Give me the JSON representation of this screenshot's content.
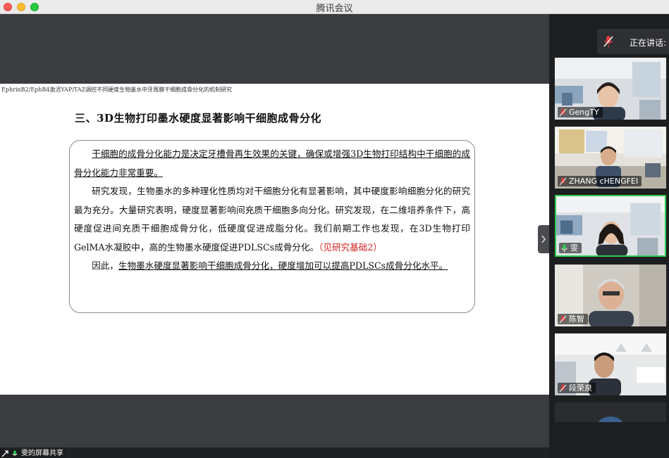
{
  "window": {
    "title": "腾讯会议"
  },
  "slide": {
    "header": "EphrinB2/EphB4激活YAP/TAZ调控不同硬度生物墨水中牙周膜干细胞成骨分化的机制研究",
    "heading": "三、3D生物打印墨水硬度显著影响干细胞成骨分化",
    "p1": "干细胞的成骨分化能力是决定牙槽骨再生效果的关键，确保或增强3D生物打印结构中干细胞的成骨分化能力非常重要。",
    "p2": "研究发现，生物墨水的多种理化性质均对干细胞分化有显著影响，其中硬度影响细胞分化的研究最为充分。大量研究表明，硬度显著影响间充质干细胞多向分化。研究发现，在二维培养条件下，高硬度促进间充质干细胞成骨分化，低硬度促进成脂分化。我们前期工作也发现，在3D生物打印GelMA水凝胶中，高的生物墨水硬度促进PDLSCs成骨分化。",
    "p2_ref": "（见研究基础2）",
    "p3_lead": "因此，",
    "p3_underline": "生物墨水硬度显著影响干细胞成骨分化，硬度增加可以提高PDLSCs成骨分化水平。"
  },
  "sharer": {
    "label": "雯的屏幕共享"
  },
  "speaking": {
    "label": "正在讲话:"
  },
  "participants": [
    {
      "name": "GengTY",
      "muted": true,
      "active": false
    },
    {
      "name": "ZHANG cHENGFEI",
      "muted": true,
      "active": false
    },
    {
      "name": "雯",
      "muted": false,
      "active": true
    },
    {
      "name": "陈智",
      "muted": true,
      "active": false
    },
    {
      "name": "段荣泉",
      "muted": true,
      "active": false
    }
  ],
  "colors": {
    "accent_green": "#2fce53",
    "muted_red": "#e03b3b",
    "reference_red": "#d62020"
  }
}
